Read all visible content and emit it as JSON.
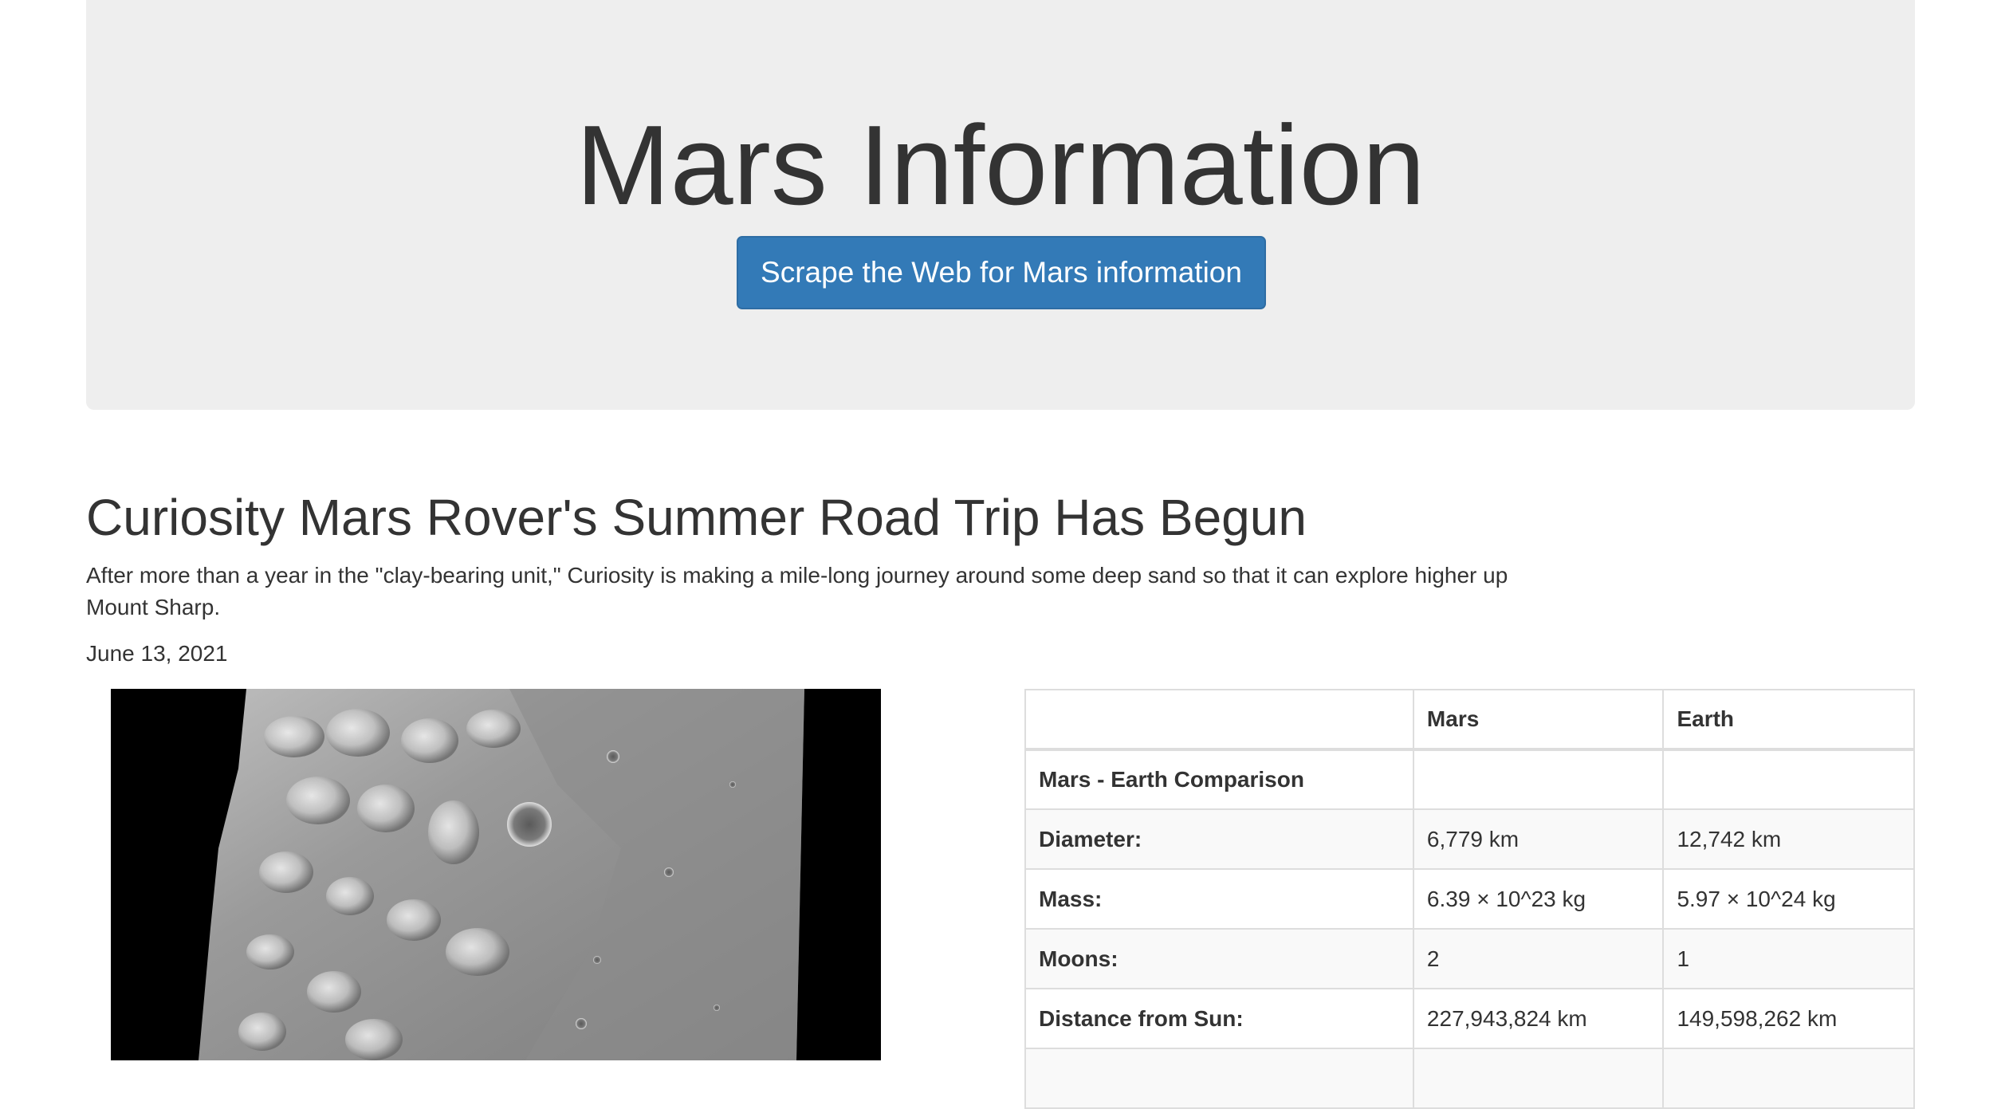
{
  "jumbotron": {
    "title": "Mars Information",
    "scrape_button": "Scrape the Web for Mars information"
  },
  "news": {
    "title": "Curiosity Mars Rover's Summer Road Trip Has Begun",
    "teaser": "After more than a year in the \"clay-bearing unit,\" Curiosity is making a mile-long journey around some deep sand so that it can explore higher up Mount Sharp.",
    "date": "June 13, 2021"
  },
  "facts": {
    "headers": [
      "",
      "Mars",
      "Earth"
    ],
    "rows": [
      {
        "label": "Mars - Earth Comparison",
        "mars": "",
        "earth": ""
      },
      {
        "label": "Diameter:",
        "mars": "6,779 km",
        "earth": "12,742 km"
      },
      {
        "label": "Mass:",
        "mars": "6.39 × 10^23 kg",
        "earth": "5.97 × 10^24 kg"
      },
      {
        "label": "Moons:",
        "mars": "2",
        "earth": "1"
      },
      {
        "label": "Distance from Sun:",
        "mars": "227,943,824 km",
        "earth": "149,598,262 km"
      },
      {
        "label": "",
        "mars": "",
        "earth": ""
      }
    ]
  },
  "colors": {
    "button_primary": "#337ab7",
    "jumbotron_bg": "#eeeeee",
    "text": "#333333"
  }
}
